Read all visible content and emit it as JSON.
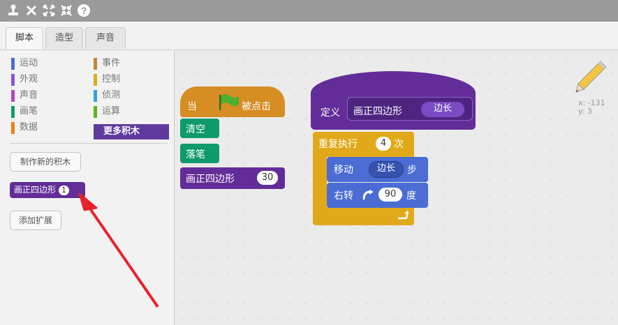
{
  "tabs": {
    "scripts": "脚本",
    "costumes": "造型",
    "sounds": "声音"
  },
  "categories": [
    {
      "label": "运动",
      "color": "#4a6cd4"
    },
    {
      "label": "外观",
      "color": "#8a55d7"
    },
    {
      "label": "声音",
      "color": "#bb42c3"
    },
    {
      "label": "画笔",
      "color": "#0e9a6c"
    },
    {
      "label": "数据",
      "color": "#ee7d16"
    },
    {
      "label": "事件",
      "color": "#c88330"
    },
    {
      "label": "控制",
      "color": "#e1a91a"
    },
    {
      "label": "侦测",
      "color": "#2ca5e2"
    },
    {
      "label": "运算",
      "color": "#5cb712"
    },
    {
      "label": "更多积木",
      "color": "#632d99"
    }
  ],
  "palette": {
    "make_block_label": "制作新的积木",
    "custom_block_label": "画正四边形",
    "custom_block_param": "1",
    "add_extension_label": "添加扩展"
  },
  "script1": {
    "hat_when": "当",
    "hat_clicked": "被点击",
    "clear": "清空",
    "pen_down": "落笔",
    "call_label": "画正四边形",
    "call_value": "30"
  },
  "script2": {
    "define": "定义",
    "define_name": "画正四边形",
    "define_param": "边长",
    "repeat": "重复执行",
    "repeat_count": "4",
    "repeat_unit": "次",
    "move": "移动",
    "move_param": "边长",
    "move_unit": "步",
    "turn": "右转",
    "turn_value": "90",
    "turn_unit": "度"
  },
  "sprite_info": {
    "x": "x: -131",
    "y": "y: 3"
  },
  "colors": {
    "pen": "#0e9a6c",
    "events": "#c88330",
    "control": "#e1a91a",
    "motion": "#4a6cd4",
    "more_blocks": "#632d99",
    "arrow": "#e8232a"
  }
}
